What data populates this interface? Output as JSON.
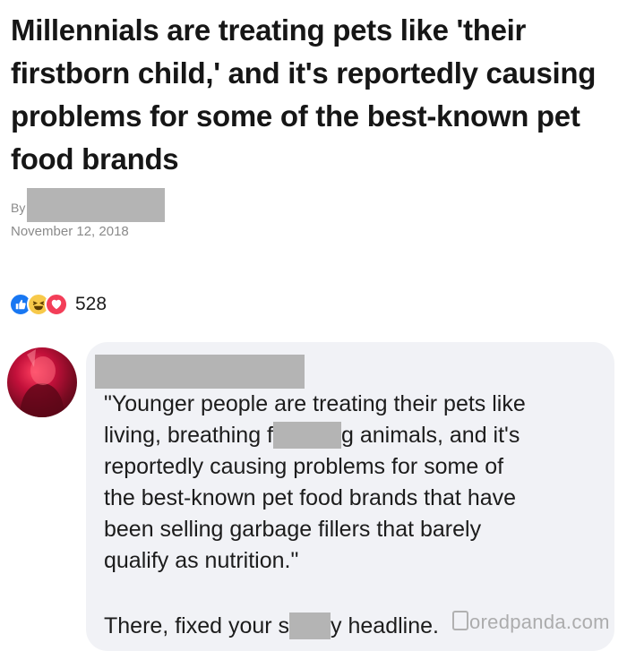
{
  "article": {
    "headline": "Millennials are treating pets like 'their firstborn child,' and it's reportedly causing problems for some of the best-known pet food brands",
    "by_label": "By",
    "date": "November 12, 2018"
  },
  "reactions": {
    "icons": [
      "like-icon",
      "haha-icon",
      "love-icon"
    ],
    "count": "528"
  },
  "comment": {
    "lines": [
      "\"Younger people are treating their pets like",
      "living, breathing f",
      "g animals, and it's",
      "reportedly causing problems for some of",
      "the best-known pet food brands that have",
      "been selling garbage fillers that barely",
      "qualify as nutrition.\""
    ],
    "fixed_part1": "There, fixed your s",
    "fixed_part2": "y headline."
  },
  "watermark": "oredpanda.com",
  "colors": {
    "like": "#1877f2",
    "haha": "#f7c94a",
    "love": "#f33e58",
    "bubble": "#f1f2f6",
    "redaction": "#b4b4b4"
  }
}
